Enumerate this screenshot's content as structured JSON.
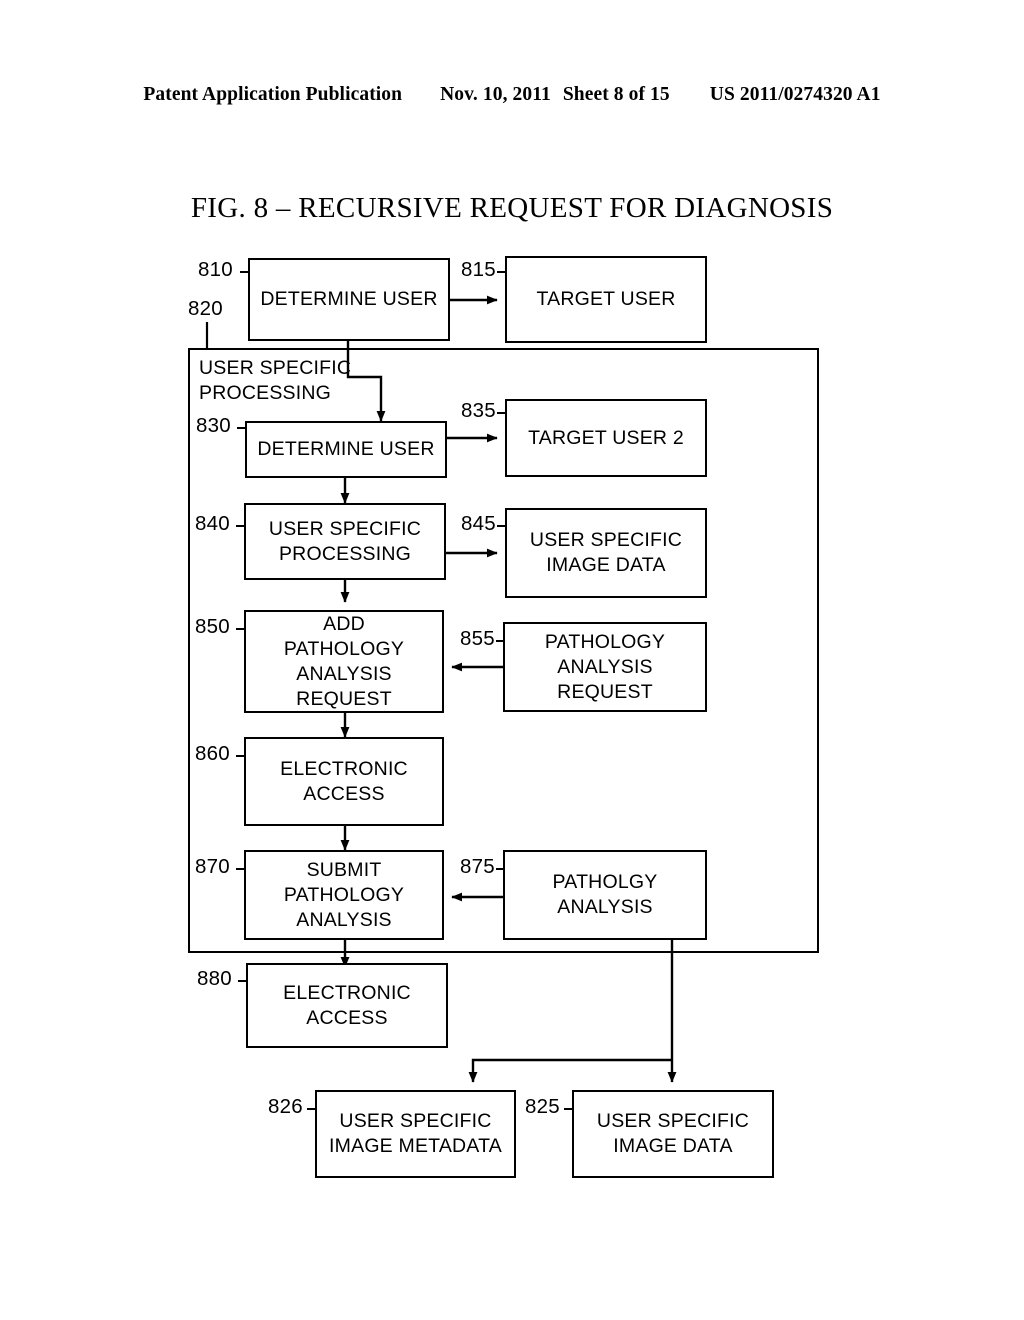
{
  "header": {
    "publication": "Patent Application Publication",
    "date": "Nov. 10, 2011",
    "sheet": "Sheet 8 of 15",
    "patent_number": "US 2011/0274320 A1"
  },
  "figure": {
    "title": "FIG. 8 – RECURSIVE REQUEST FOR DIAGNOSIS"
  },
  "group": {
    "ref": "820",
    "title": "USER SPECIFIC\nPROCESSING"
  },
  "nodes": [
    {
      "ref": "810",
      "label": "DETERMINE USER"
    },
    {
      "ref": "815",
      "label": "TARGET USER"
    },
    {
      "ref": "830",
      "label": "DETERMINE USER"
    },
    {
      "ref": "835",
      "label": "TARGET USER 2"
    },
    {
      "ref": "840",
      "label": "USER SPECIFIC\nPROCESSING"
    },
    {
      "ref": "845",
      "label": "USER SPECIFIC\nIMAGE DATA"
    },
    {
      "ref": "850",
      "label": "ADD\nPATHOLOGY\nANALYSIS\nREQUEST"
    },
    {
      "ref": "855",
      "label": "PATHOLOGY\nANALYSIS\nREQUEST"
    },
    {
      "ref": "860",
      "label": "ELECTRONIC\nACCESS"
    },
    {
      "ref": "870",
      "label": "SUBMIT\nPATHOLOGY\nANALYSIS"
    },
    {
      "ref": "875",
      "label": "PATHOLGY\nANALYSIS"
    },
    {
      "ref": "880",
      "label": "ELECTRONIC\nACCESS"
    },
    {
      "ref": "826",
      "label": "USER SPECIFIC\nIMAGE METADATA"
    },
    {
      "ref": "825",
      "label": "USER SPECIFIC\nIMAGE DATA"
    }
  ],
  "chart_data": {
    "type": "diagram",
    "title": "FIG. 8 – RECURSIVE REQUEST FOR DIAGNOSIS",
    "blocks": [
      {
        "id": "810",
        "text": "DETERMINE USER"
      },
      {
        "id": "815",
        "text": "TARGET USER"
      },
      {
        "id": "820",
        "text": "USER SPECIFIC PROCESSING",
        "kind": "container"
      },
      {
        "id": "830",
        "text": "DETERMINE USER"
      },
      {
        "id": "835",
        "text": "TARGET USER 2"
      },
      {
        "id": "840",
        "text": "USER SPECIFIC PROCESSING"
      },
      {
        "id": "845",
        "text": "USER SPECIFIC IMAGE DATA"
      },
      {
        "id": "850",
        "text": "ADD PATHOLOGY ANALYSIS REQUEST"
      },
      {
        "id": "855",
        "text": "PATHOLOGY ANALYSIS REQUEST"
      },
      {
        "id": "860",
        "text": "ELECTRONIC ACCESS"
      },
      {
        "id": "870",
        "text": "SUBMIT PATHOLOGY ANALYSIS"
      },
      {
        "id": "875",
        "text": "PATHOLGY ANALYSIS"
      },
      {
        "id": "880",
        "text": "ELECTRONIC ACCESS"
      },
      {
        "id": "826",
        "text": "USER SPECIFIC IMAGE METADATA"
      },
      {
        "id": "825",
        "text": "USER SPECIFIC IMAGE DATA"
      }
    ],
    "edges": [
      {
        "from": "810",
        "to": "815"
      },
      {
        "from": "810",
        "to": "830"
      },
      {
        "from": "830",
        "to": "835"
      },
      {
        "from": "830",
        "to": "840"
      },
      {
        "from": "840",
        "to": "845"
      },
      {
        "from": "840",
        "to": "850"
      },
      {
        "from": "855",
        "to": "850"
      },
      {
        "from": "850",
        "to": "860"
      },
      {
        "from": "860",
        "to": "870"
      },
      {
        "from": "875",
        "to": "870"
      },
      {
        "from": "870",
        "to": "880"
      },
      {
        "from": "875",
        "to": "826"
      },
      {
        "from": "875",
        "to": "825"
      }
    ]
  }
}
